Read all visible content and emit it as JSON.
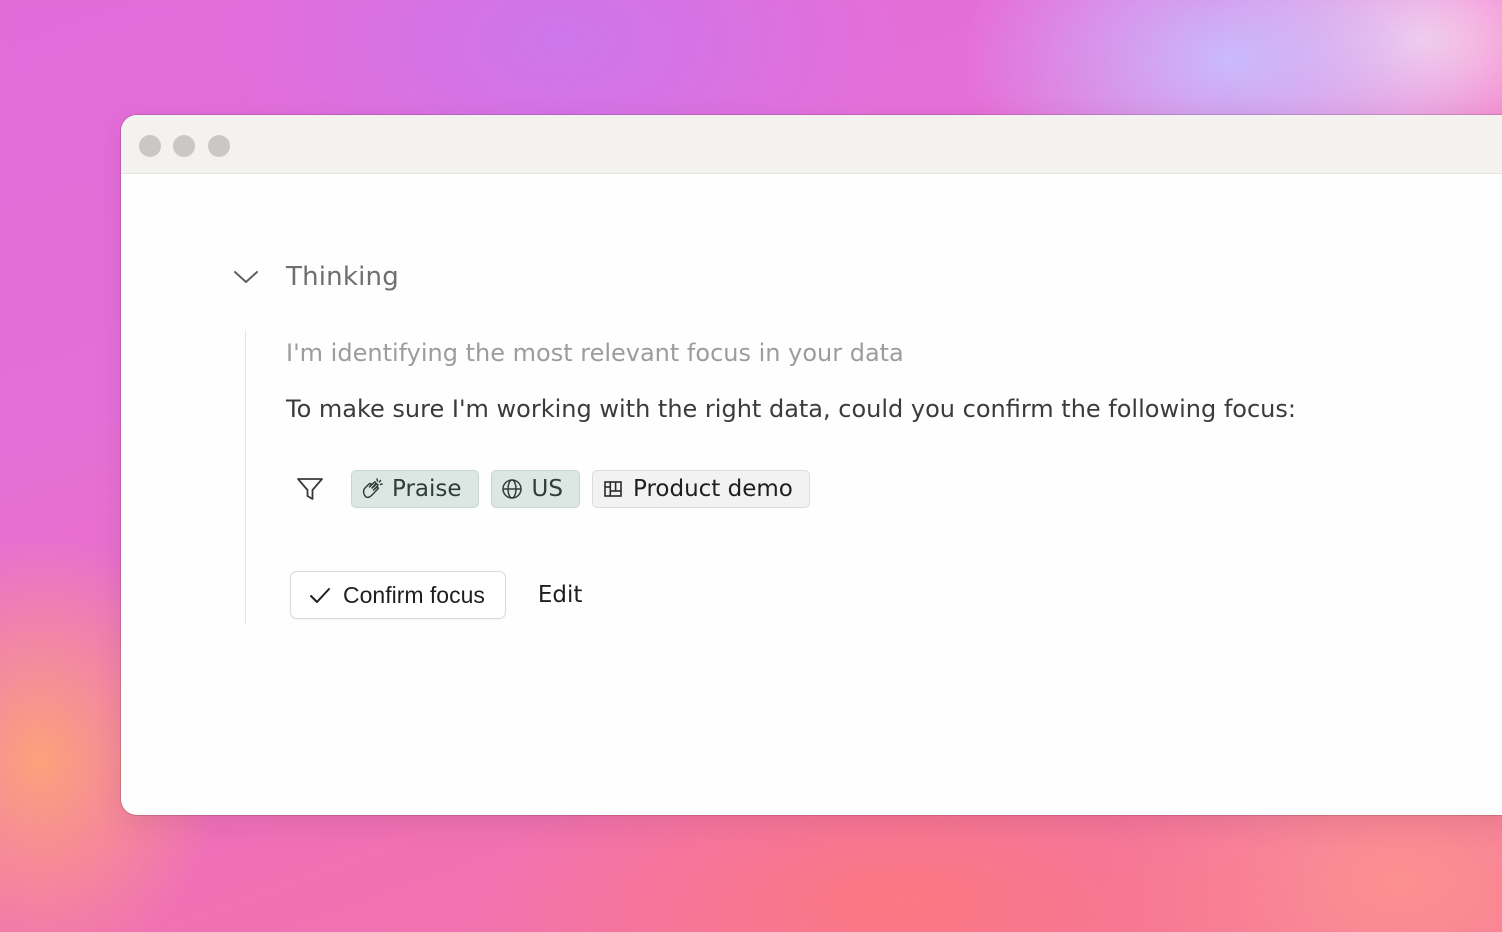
{
  "thinking": {
    "label": "Thinking",
    "status": "I'm identifying the most relevant focus in your data",
    "question": "To make sure I'm working with the right data, could you confirm the following focus:"
  },
  "filters": {
    "icon": "filter-icon",
    "chips": [
      {
        "label": "Praise",
        "icon": "clapping-hands-icon",
        "style": "highlighted",
        "color": "#dce7e3"
      },
      {
        "label": "US",
        "icon": "globe-icon",
        "style": "highlighted",
        "color": "#dce7e3"
      },
      {
        "label": "Product demo",
        "icon": "board-icon",
        "style": "neutral",
        "color": "#f2f2f2"
      }
    ]
  },
  "actions": {
    "confirm_label": "Confirm focus",
    "edit_label": "Edit"
  }
}
